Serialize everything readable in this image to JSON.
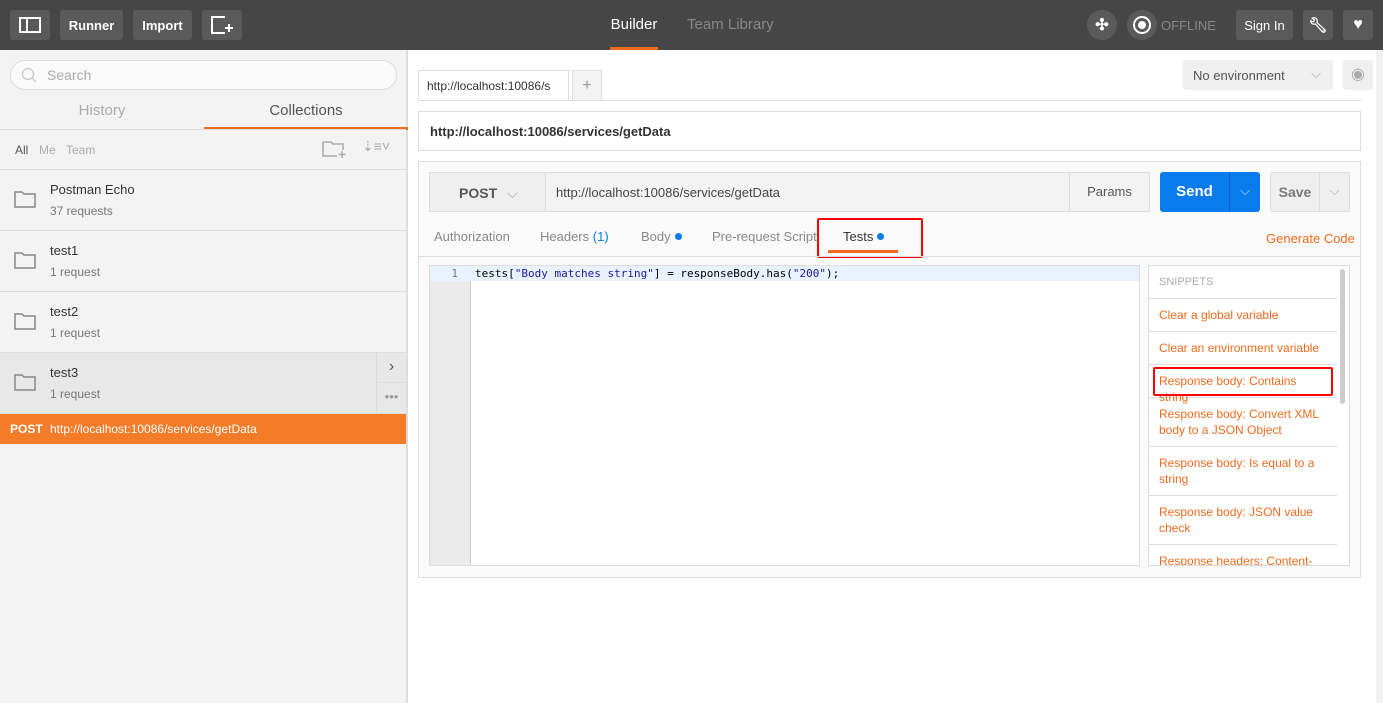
{
  "header": {
    "runner": "Runner",
    "import": "Import",
    "tabs": [
      "Builder",
      "Team Library"
    ],
    "offline": "OFFLINE",
    "sign_in": "Sign In"
  },
  "sidebar": {
    "search_placeholder": "Search",
    "tabs": [
      "History",
      "Collections"
    ],
    "filters": [
      "All",
      "Me",
      "Team"
    ],
    "collections": [
      {
        "name": "Postman Echo",
        "count": "37 requests"
      },
      {
        "name": "test1",
        "count": "1 request"
      },
      {
        "name": "test2",
        "count": "1 request"
      },
      {
        "name": "test3",
        "count": "1 request"
      }
    ],
    "active_request": {
      "method": "POST",
      "url": "http://localhost:10086/services/getData"
    }
  },
  "main": {
    "request_tab": "http://localhost:10086/s",
    "environment": "No environment",
    "url_title": "http://localhost:10086/services/getData",
    "method": "POST",
    "url": "http://localhost:10086/services/getData",
    "params": "Params",
    "send": "Send",
    "save": "Save",
    "tabs": {
      "authorization": "Authorization",
      "headers": "Headers",
      "headers_count": "(1)",
      "body": "Body",
      "prerequest": "Pre-request Script",
      "tests": "Tests"
    },
    "generate_code": "Generate Code",
    "editor": {
      "line_number": "1",
      "code": {
        "p1": "tests[",
        "s1": "\"Body matches string\"",
        "p2": "] = responseBody.has(",
        "s2": "\"200\"",
        "p3": ");"
      }
    },
    "snippets": {
      "title": "SNIPPETS",
      "items": [
        "Clear a global variable",
        "Clear an environment variable",
        "Response body: Contains string",
        "Response body: Convert XML body to a JSON Object",
        "Response body: Is equal to a string",
        "Response body: JSON value check",
        "Response headers: Content-"
      ]
    }
  },
  "colors": {
    "accent": "#f26b1d",
    "send": "#097bed",
    "highlight": "#ff0000"
  }
}
